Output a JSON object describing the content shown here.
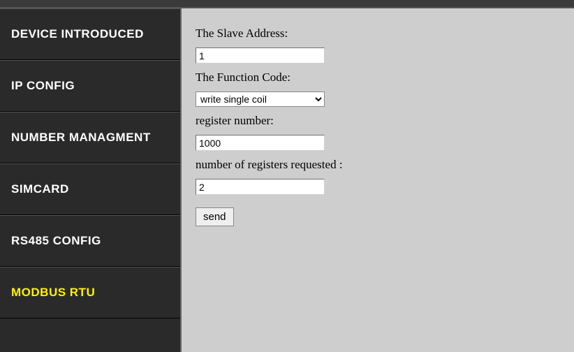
{
  "sidebar": {
    "items": [
      {
        "label": "DEVICE INTRODUCED",
        "active": false
      },
      {
        "label": "IP CONFIG",
        "active": false
      },
      {
        "label": "NUMBER MANAGMENT",
        "active": false
      },
      {
        "label": "SIMCARD",
        "active": false
      },
      {
        "label": "RS485 CONFIG",
        "active": false
      },
      {
        "label": "MODBUS RTU",
        "active": true
      }
    ]
  },
  "form": {
    "slave_address": {
      "label": "The Slave Address:",
      "value": "1"
    },
    "function_code": {
      "label": "The Function Code:",
      "selected": "write single coil"
    },
    "register_number": {
      "label": "register number:",
      "value": "1000"
    },
    "num_registers": {
      "label": "number of registers requested :",
      "value": "2"
    },
    "submit_label": "send"
  }
}
